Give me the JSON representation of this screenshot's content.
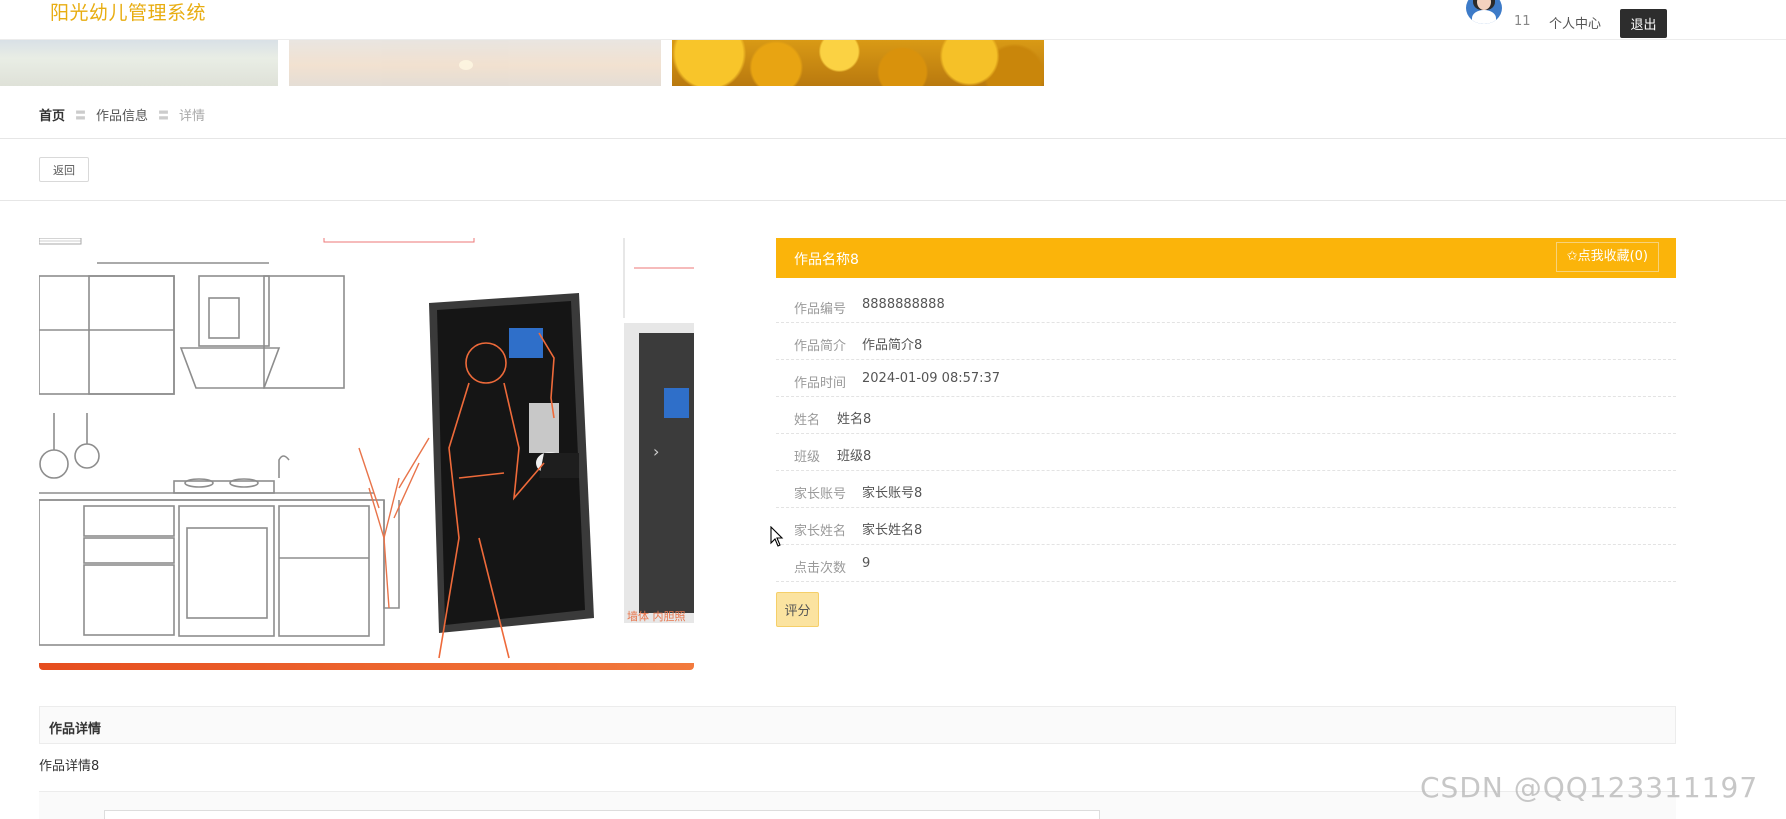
{
  "header": {
    "site_title": "阳光幼儿管理系统",
    "user_count": "11",
    "center_link": "个人中心",
    "logout_label": "退出"
  },
  "breadcrumb": {
    "home": "首页",
    "separator": "〓",
    "list": "作品信息",
    "current": "详情"
  },
  "back_label": "返回",
  "product": {
    "name": "作品名称8",
    "favorite_label": "✩点我收藏(0)",
    "fields": [
      {
        "label": "作品编号",
        "value": "8888888888"
      },
      {
        "label": "作品简介",
        "value": "作品简介8"
      },
      {
        "label": "作品时间",
        "value": "2024-01-09 08:57:37"
      },
      {
        "label": "姓名",
        "value": "姓名8"
      },
      {
        "label": "班级",
        "value": "班级8"
      },
      {
        "label": "家长账号",
        "value": "家长账号8"
      },
      {
        "label": "家长姓名",
        "value": "家长姓名8"
      },
      {
        "label": "点击次数",
        "value": "9"
      }
    ],
    "rate_label": "评分"
  },
  "gallery": {
    "next_icon": "›",
    "image_caption": "墙体 内胆照"
  },
  "detail": {
    "title": "作品详情",
    "content": "作品详情8"
  },
  "watermark": "CSDN @QQ123311197",
  "colors": {
    "accent": "#fbb40a",
    "title": "#e8ad11",
    "logout_bg": "#2d2d2d"
  }
}
